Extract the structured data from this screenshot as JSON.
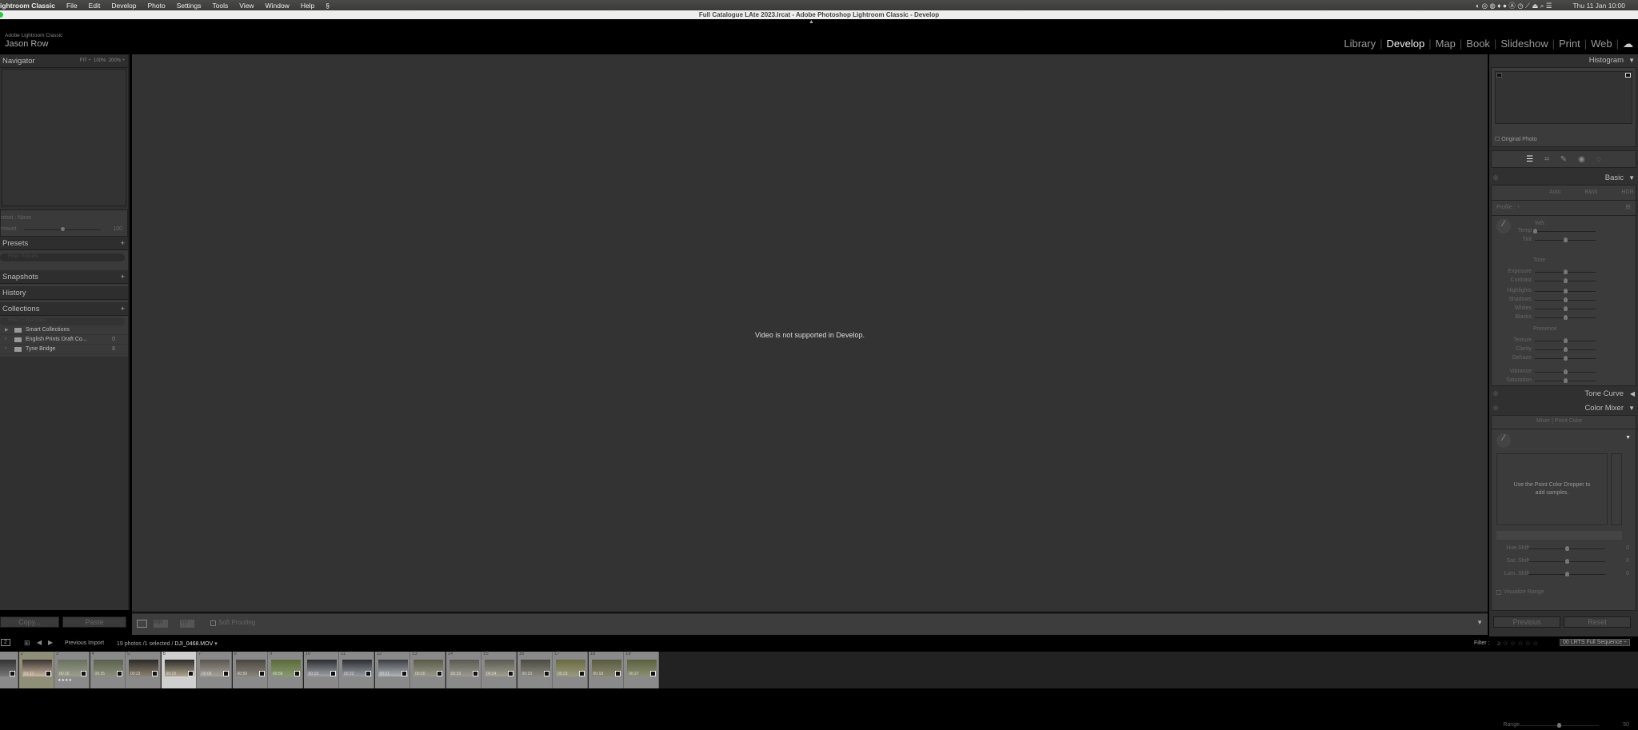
{
  "menubar": {
    "app": "ightroom Classic",
    "items": [
      "File",
      "Edit",
      "Develop",
      "Photo",
      "Settings",
      "Tools",
      "View",
      "Window",
      "Help"
    ],
    "clock": "Thu 11 Jan 10:00"
  },
  "window": {
    "title": "Full Catalogue LAte 2023.lrcat - Adobe Photoshop Lightroom Classic - Develop"
  },
  "identity": {
    "product": "Adobe Lightroom Classic",
    "user": "Jason Row"
  },
  "modules": [
    {
      "label": "Library"
    },
    {
      "label": "Develop",
      "active": true
    },
    {
      "label": "Map"
    },
    {
      "label": "Book"
    },
    {
      "label": "Slideshow"
    },
    {
      "label": "Print"
    },
    {
      "label": "Web"
    }
  ],
  "left": {
    "navigator": {
      "title": "Navigator",
      "zoom": [
        "FIT ÷",
        "100%",
        "200% ÷"
      ]
    },
    "preset": {
      "label": "reset : None",
      "amount_label": "mount",
      "amount": 100,
      "amount_text": "100"
    },
    "presets": {
      "title": "Presets",
      "filter_placeholder": "Filter Presets"
    },
    "snapshots": {
      "title": "Snapshots"
    },
    "history": {
      "title": "History"
    },
    "collections": {
      "title": "Collections",
      "filter_placeholder": "Filter Collections",
      "items": [
        {
          "name": "Smart Collections",
          "count": ""
        },
        {
          "name": "English Prints Draft Co...",
          "count": "0"
        },
        {
          "name": "Tyne Bridge",
          "count": "6"
        }
      ]
    },
    "copy": "Copy...",
    "paste": "Paste"
  },
  "center": {
    "message": "Video is not supported in Develop.",
    "soft_proofing": "Soft Proofing"
  },
  "right": {
    "histogram": {
      "title": "Histogram",
      "original_photo": "Original Photo"
    },
    "basic": {
      "title": "Basic",
      "auto": "Auto",
      "bw": "B&W",
      "hdr": "HDR",
      "profile": "Profile :",
      "wb": "WB :",
      "tone": "Tone",
      "presence": "Presence",
      "sliders": [
        {
          "label": "Temp",
          "value": 0
        },
        {
          "label": "Tint",
          "value": 0.5
        },
        {
          "label": "Exposure",
          "value": 0.5
        },
        {
          "label": "Contrast",
          "value": 0.5
        },
        {
          "label": "Highlights",
          "value": 0.5
        },
        {
          "label": "Shadows",
          "value": 0.5
        },
        {
          "label": "Whites",
          "value": 0.5
        },
        {
          "label": "Blacks",
          "value": 0.5
        },
        {
          "label": "Texture",
          "value": 0.5
        },
        {
          "label": "Clarity",
          "value": 0.5
        },
        {
          "label": "Dehaze",
          "value": 0.5
        },
        {
          "label": "Vibrance",
          "value": 0.5
        },
        {
          "label": "Saturation",
          "value": 0.5
        }
      ]
    },
    "tone_curve": {
      "title": "Tone Curve"
    },
    "color_mixer": {
      "title": "Color Mixer",
      "mixer": "Mixer",
      "point_color": "Point Color",
      "hint": "Use the Point Color Dropper to add samples.",
      "sliders": [
        {
          "label": "Hue Shift",
          "value": 0.5,
          "text": "0"
        },
        {
          "label": "Sat. Shift",
          "value": 0.5,
          "text": "0"
        },
        {
          "label": "Lum. Shift",
          "value": 0.5,
          "text": "0"
        }
      ],
      "range": {
        "label": "Range",
        "value": 0.5,
        "text": "50"
      },
      "visualize": "Visualize Range"
    },
    "previous": "Previous",
    "reset": "Reset"
  },
  "filmstrip": {
    "page": "2",
    "source": "Previous Import",
    "count": "19 photos /1 selected /",
    "file": "DJI_0468.MOV",
    "filter_label": "Filter :",
    "filter_preset": "00 LRTS Full Sequence",
    "selected": 6,
    "items": [
      {
        "n": "",
        "d": ""
      },
      {
        "n": "2",
        "d": "00:22"
      },
      {
        "n": "3",
        "d": "00:16",
        "stars": "★★★★"
      },
      {
        "n": "4",
        "d": "00:25"
      },
      {
        "n": "5",
        "d": "00:22"
      },
      {
        "n": "6",
        "d": "00:23"
      },
      {
        "n": "7",
        "d": "00:06"
      },
      {
        "n": "8",
        "d": "00:50"
      },
      {
        "n": "9",
        "d": "00:56"
      },
      {
        "n": "10",
        "d": "00:19"
      },
      {
        "n": "11",
        "d": "00:22"
      },
      {
        "n": "12",
        "d": "00:21"
      },
      {
        "n": "13",
        "d": "00:20"
      },
      {
        "n": "14",
        "d": "00:19"
      },
      {
        "n": "15",
        "d": "00:24"
      },
      {
        "n": "16",
        "d": "00:23"
      },
      {
        "n": "17",
        "d": "00:23"
      },
      {
        "n": "18",
        "d": "00:18"
      },
      {
        "n": "19",
        "d": "00:27"
      }
    ]
  }
}
